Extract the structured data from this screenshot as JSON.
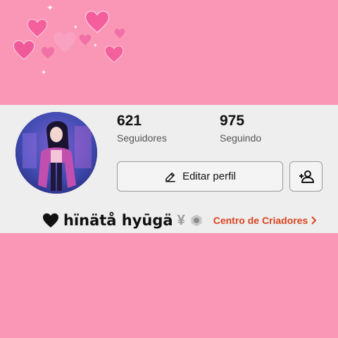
{
  "profile": {
    "followers_count": "621",
    "followers_label": "Seguidores",
    "following_count": "975",
    "following_label": "Seguindo",
    "display_name": "hïnätå hyūgä",
    "name_suffix": "¥",
    "creator_center_label": "Centro de Criadores"
  },
  "buttons": {
    "edit_profile_label": "Editar perfil"
  },
  "icons": {
    "edit": "pencil-icon",
    "add_friend": "add-person-icon",
    "verified": "hexagon-badge-icon",
    "chevron": "chevron-right-icon",
    "heart": "black-heart-icon"
  },
  "colors": {
    "background_pink": "#fa97b6",
    "card": "#efeeee",
    "link": "#d8431e",
    "heart_decor": "#f2609a"
  }
}
